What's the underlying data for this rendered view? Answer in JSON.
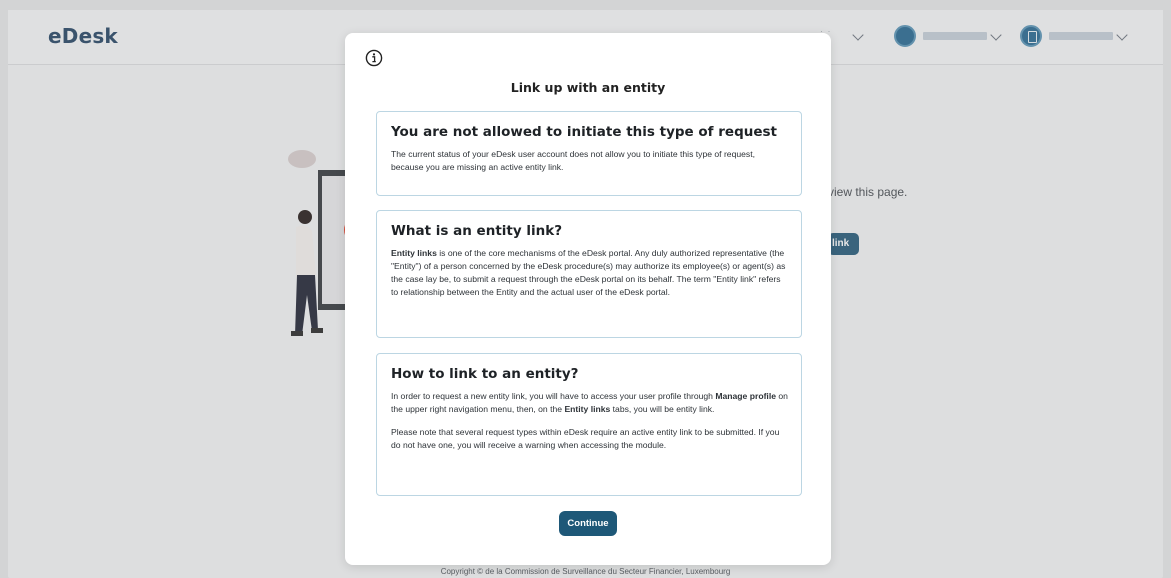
{
  "app": {
    "brand": "eDesk"
  },
  "background": {
    "notice_fragment": "view this page.",
    "button_fragment": "link",
    "footer": "Copyright © de la Commission de Surveillance du Secteur Financier, Luxembourg"
  },
  "header": {
    "menus": [
      {
        "icon": "chevron-down-icon"
      },
      {
        "icon": "user-avatar-icon"
      },
      {
        "icon": "organization-avatar-icon"
      }
    ]
  },
  "modal": {
    "icon": "info-icon",
    "title": "Link up with an entity",
    "cards": {
      "not_allowed": {
        "title": "You are not allowed to initiate this type of request",
        "body": "The current status of your eDesk user account does not allow you to initiate this type of request, because you are missing an active entity link."
      },
      "what_is": {
        "title": "What is an entity link?",
        "body_bold": "Entity links",
        "body": " is one of the core mechanisms of the eDesk portal. Any duly authorized representative (the \"Entity\") of a person concerned by the eDesk procedure(s) may authorize its employee(s) or agent(s) as the case lay be, to submit a request through the eDesk portal on its behalf. The term \"Entity link\" refers to relationship between the Entity and the actual user of the eDesk portal."
      },
      "how_to": {
        "title": "How to link to an entity?",
        "p1_start": "In order to request a new entity link, you will have to access your user profile through ",
        "p1_bold1": "Manage profile",
        "p1_mid": " on the upper right navigation menu, then, on the ",
        "p1_bold2": "Entity links",
        "p1_end": " tabs, you will be entity link.",
        "p2": "Please note that several request types within eDesk require an active entity link to be submitted. If you do not have one, you will receive a warning when accessing the module."
      }
    },
    "continue_label": "Continue"
  },
  "colors": {
    "brand": "#2b4a68",
    "accent": "#1e5878",
    "card_border": "#bcd6e3"
  }
}
